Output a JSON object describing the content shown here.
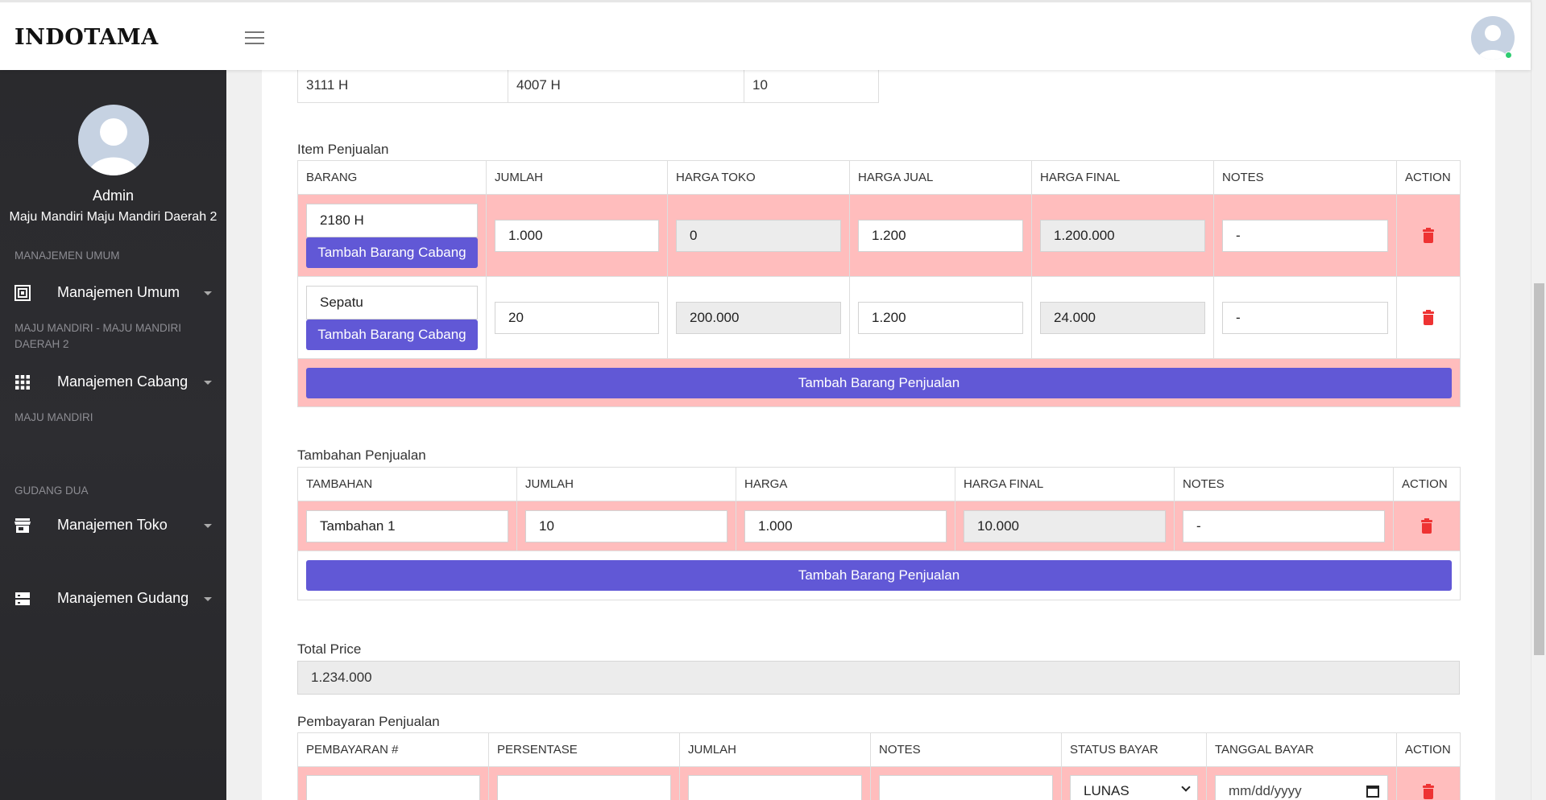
{
  "app": {
    "brand": "INDOTAMA"
  },
  "user": {
    "name": "Admin",
    "company": "Maju Mandiri Maju Mandiri Daerah 2"
  },
  "sidebar": {
    "sections": [
      {
        "title": "MANAJEMEN UMUM",
        "item": "Manajemen Umum",
        "icon": "dashboard-icon"
      },
      {
        "title": "MAJU MANDIRI - MAJU MANDIRI DAERAH 2",
        "item": "Manajemen Cabang",
        "icon": "grid-icon"
      },
      {
        "title": "MAJU MANDIRI",
        "item": "Manajemen Toko",
        "icon": "store-icon"
      },
      {
        "title": "GUDANG DUA",
        "item": "Manajemen Gudang",
        "icon": "server-icon"
      }
    ]
  },
  "top_row": {
    "values": [
      "3111 H",
      "4007 H",
      "10"
    ]
  },
  "item_penjualan": {
    "title": "Item Penjualan",
    "headers": [
      "BARANG",
      "JUMLAH",
      "HARGA TOKO",
      "HARGA JUAL",
      "HARGA FINAL",
      "NOTES",
      "ACTION"
    ],
    "rows": [
      {
        "barang": "2180 H",
        "branch_button": "Tambah Barang Cabang",
        "jumlah": "1.000",
        "harga_toko": "0",
        "harga_jual": "1.200",
        "harga_final": "1.200.000",
        "notes": "-"
      },
      {
        "barang": "Sepatu",
        "branch_button": "Tambah Barang Cabang",
        "jumlah": "20",
        "harga_toko": "200.000",
        "harga_jual": "1.200",
        "harga_final": "24.000",
        "notes": "-"
      }
    ],
    "add_button": "Tambah Barang Penjualan"
  },
  "tambahan_penjualan": {
    "title": "Tambahan Penjualan",
    "headers": [
      "TAMBAHAN",
      "JUMLAH",
      "HARGA",
      "HARGA FINAL",
      "NOTES",
      "ACTION"
    ],
    "rows": [
      {
        "tambahan": "Tambahan 1",
        "jumlah": "10",
        "harga": "1.000",
        "harga_final": "10.000",
        "notes": "-"
      }
    ],
    "add_button": "Tambah Barang Penjualan"
  },
  "total": {
    "label": "Total Price",
    "value": "1.234.000"
  },
  "pembayaran_penjualan": {
    "title": "Pembayaran Penjualan",
    "headers": [
      "PEMBAYARAN #",
      "PERSENTASE",
      "JUMLAH",
      "NOTES",
      "STATUS BAYAR",
      "TANGGAL BAYAR",
      "ACTION"
    ],
    "row": {
      "status": "LUNAS",
      "date_placeholder": "mm/dd/yyyy"
    }
  },
  "colors": {
    "accent": "#6158d6",
    "row_highlight": "#ffbdbd",
    "delete": "#ee3333",
    "sidebar_bg": "#2c2c2f"
  }
}
